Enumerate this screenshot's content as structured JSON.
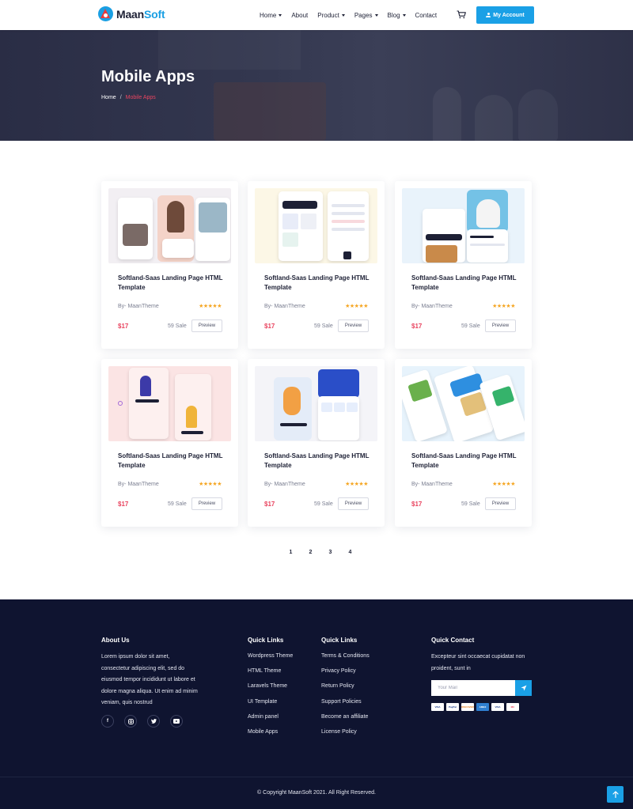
{
  "header": {
    "logo": {
      "part1": "Maan",
      "part2": "Soft"
    },
    "nav": [
      {
        "label": "Home",
        "dropdown": true
      },
      {
        "label": "About",
        "dropdown": false
      },
      {
        "label": "Product",
        "dropdown": true
      },
      {
        "label": "Pages",
        "dropdown": true
      },
      {
        "label": "Blog",
        "dropdown": true
      },
      {
        "label": "Contact",
        "dropdown": false
      }
    ],
    "account_label": "My Account"
  },
  "hero": {
    "title": "Mobile Apps",
    "breadcrumb": {
      "home": "Home",
      "separator": "/",
      "current": "Mobile Apps"
    }
  },
  "products": [
    {
      "title": "Softland-Saas Landing Page HTML Template",
      "author": "By- MaanTheme",
      "rating": 5,
      "stars": "★★★★★",
      "price": "$17",
      "sales": "59 Sale",
      "preview_label": "Preview"
    },
    {
      "title": "Softland-Saas Landing Page HTML Template",
      "author": "By- MaanTheme",
      "rating": 5,
      "stars": "★★★★★",
      "price": "$17",
      "sales": "59 Sale",
      "preview_label": "Preview"
    },
    {
      "title": "Softland-Saas Landing Page HTML Template",
      "author": "By- MaanTheme",
      "rating": 5,
      "stars": "★★★★★",
      "price": "$17",
      "sales": "59 Sale",
      "preview_label": "Preview"
    },
    {
      "title": "Softland-Saas Landing Page HTML Template",
      "author": "By- MaanTheme",
      "rating": 5,
      "stars": "★★★★★",
      "price": "$17",
      "sales": "59 Sale",
      "preview_label": "Preview"
    },
    {
      "title": "Softland-Saas Landing Page HTML Template",
      "author": "By- MaanTheme",
      "rating": 5,
      "stars": "★★★★★",
      "price": "$17",
      "sales": "59 Sale",
      "preview_label": "Preview"
    },
    {
      "title": "Softland-Saas Landing Page HTML Template",
      "author": "By- MaanTheme",
      "rating": 5,
      "stars": "★★★★★",
      "price": "$17",
      "sales": "59 Sale",
      "preview_label": "Preview"
    }
  ],
  "pagination": [
    "1",
    "2",
    "3",
    "4"
  ],
  "footer": {
    "about": {
      "heading": "About Us",
      "text": "Lorem ipsum dolor sit amet, consectetur adipiscing elit, sed do eiusmod tempor incididunt ut labore et dolore magna aliqua. Ut enim ad minim veniam, quis nostrud",
      "socials": [
        "facebook",
        "instagram",
        "twitter",
        "youtube"
      ]
    },
    "quick_links_1": {
      "heading": "Quick Links",
      "items": [
        "Wordpress Theme",
        "HTML Theme",
        "Laravels Theme",
        "UI Template",
        "Admin panel",
        "Mobile Apps"
      ]
    },
    "quick_links_2": {
      "heading": "Quick Links",
      "items": [
        "Terms & Conditions",
        "Privacy Policy",
        "Return Policy",
        "Support Policies",
        "Become an affiliate",
        "License Policy"
      ]
    },
    "contact": {
      "heading": "Quick Contact",
      "text": "Excepteur sint occaecat cupidatat non proident, sunt in",
      "mail_placeholder": "Your Mail",
      "payments": [
        "VISA",
        "PayPal",
        "DISCOVER",
        "AMEX",
        "VISA",
        "MC"
      ]
    },
    "copyright": "© Copyright MaanSoft 2021. All Right Reserved."
  },
  "colors": {
    "accent": "#1aa0e6",
    "price": "#e94560",
    "footer_bg": "#0f1430",
    "stars": "#f5a623"
  }
}
